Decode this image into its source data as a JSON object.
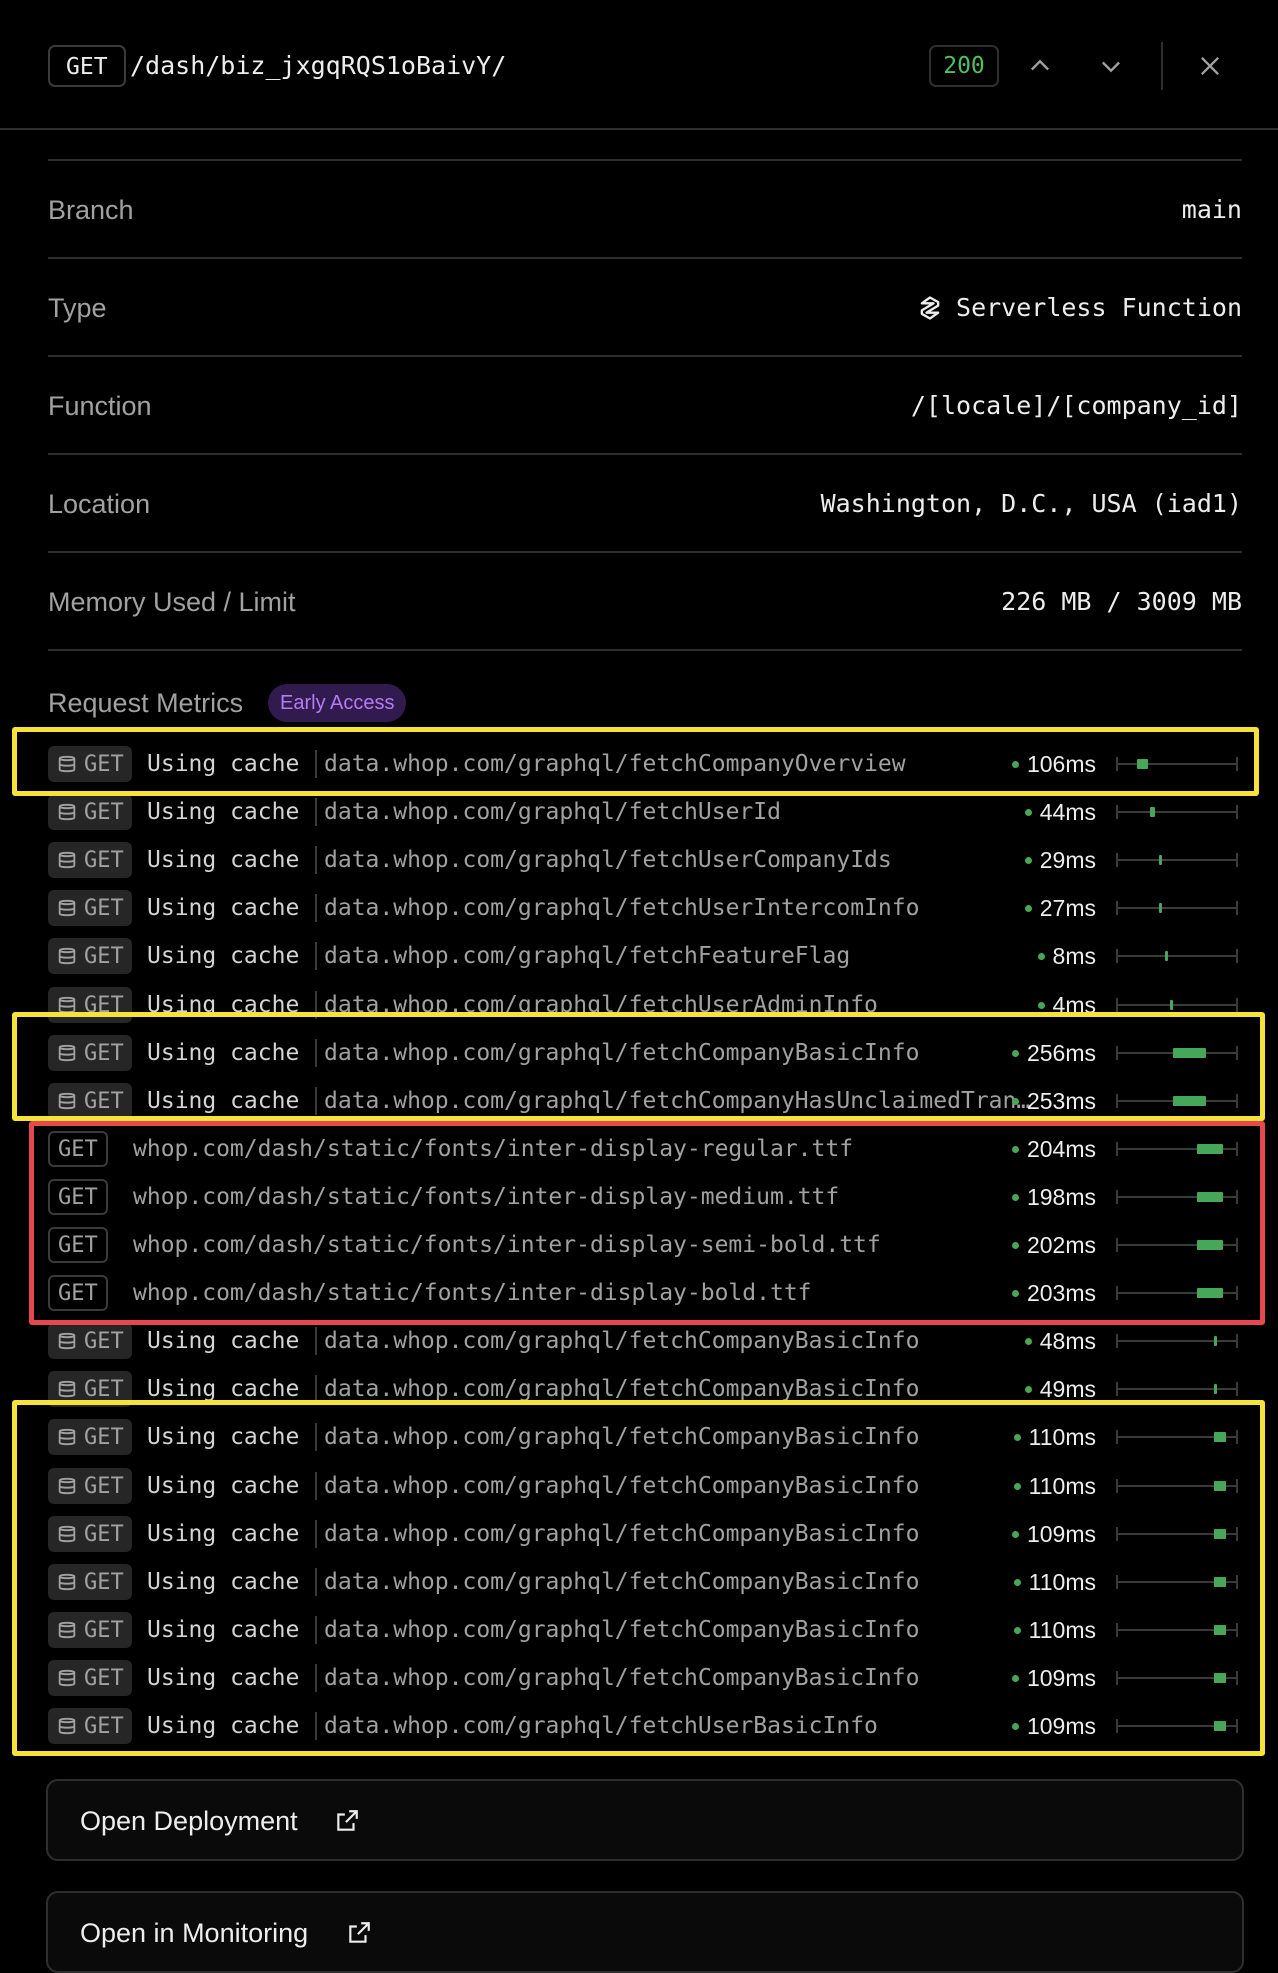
{
  "header": {
    "method": "GET",
    "path": "/dash/biz_jxgqRQS1oBaivY/",
    "status": "200",
    "prev_icon": "chevron-up-icon",
    "next_icon": "chevron-down-icon",
    "close_icon": "close-icon"
  },
  "details": [
    {
      "label": "Branch",
      "value": "main"
    },
    {
      "label": "Type",
      "value": "Serverless Function",
      "icon": "serverless-function-icon"
    },
    {
      "label": "Function",
      "value": "/[locale]/[company_id]"
    },
    {
      "label": "Location",
      "value": "Washington, D.C., USA (iad1)"
    },
    {
      "label": "Memory Used / Limit",
      "value": "226 MB / 3009 MB"
    }
  ],
  "metrics": {
    "title": "Request Metrics",
    "badge": "Early Access",
    "rows": [
      {
        "method": "GET",
        "cached": true,
        "cache_label": "Using cache",
        "url": "data.whop.com/graphql/fetchCompanyOverview",
        "duration": "106ms",
        "bar_start": 0.17,
        "bar_width": 0.09
      },
      {
        "method": "GET",
        "cached": true,
        "cache_label": "Using cache",
        "url": "data.whop.com/graphql/fetchUserId",
        "duration": "44ms",
        "bar_start": 0.28,
        "bar_width": 0.04
      },
      {
        "method": "GET",
        "cached": true,
        "cache_label": "Using cache",
        "url": "data.whop.com/graphql/fetchUserCompanyIds",
        "duration": "29ms",
        "bar_start": 0.35,
        "bar_width": 0.025
      },
      {
        "method": "GET",
        "cached": true,
        "cache_label": "Using cache",
        "url": "data.whop.com/graphql/fetchUserIntercomInfo",
        "duration": "27ms",
        "bar_start": 0.35,
        "bar_width": 0.025
      },
      {
        "method": "GET",
        "cached": true,
        "cache_label": "Using cache",
        "url": "data.whop.com/graphql/fetchFeatureFlag",
        "duration": "8ms",
        "bar_start": 0.4,
        "bar_width": 0.015
      },
      {
        "method": "GET",
        "cached": true,
        "cache_label": "Using cache",
        "url": "data.whop.com/graphql/fetchUserAdminInfo",
        "duration": "4ms",
        "bar_start": 0.44,
        "bar_width": 0.015
      },
      {
        "method": "GET",
        "cached": true,
        "cache_label": "Using cache",
        "url": "data.whop.com/graphql/fetchCompanyBasicInfo",
        "duration": "256ms",
        "bar_start": 0.47,
        "bar_width": 0.27
      },
      {
        "method": "GET",
        "cached": true,
        "cache_label": "Using cache",
        "url": "data.whop.com/graphql/fetchCompanyHasUnclaimedTransfers",
        "duration": "253ms",
        "bar_start": 0.47,
        "bar_width": 0.27
      },
      {
        "method": "GET",
        "cached": false,
        "url": "whop.com/dash/static/fonts/inter-display-regular.ttf",
        "duration": "204ms",
        "bar_start": 0.66,
        "bar_width": 0.22
      },
      {
        "method": "GET",
        "cached": false,
        "url": "whop.com/dash/static/fonts/inter-display-medium.ttf",
        "duration": "198ms",
        "bar_start": 0.66,
        "bar_width": 0.22
      },
      {
        "method": "GET",
        "cached": false,
        "url": "whop.com/dash/static/fonts/inter-display-semi-bold.ttf",
        "duration": "202ms",
        "bar_start": 0.66,
        "bar_width": 0.22
      },
      {
        "method": "GET",
        "cached": false,
        "url": "whop.com/dash/static/fonts/inter-display-bold.ttf",
        "duration": "203ms",
        "bar_start": 0.66,
        "bar_width": 0.22
      },
      {
        "method": "GET",
        "cached": true,
        "cache_label": "Using cache",
        "url": "data.whop.com/graphql/fetchCompanyBasicInfo",
        "duration": "48ms",
        "bar_start": 0.8,
        "bar_width": 0.03
      },
      {
        "method": "GET",
        "cached": true,
        "cache_label": "Using cache",
        "url": "data.whop.com/graphql/fetchCompanyBasicInfo",
        "duration": "49ms",
        "bar_start": 0.8,
        "bar_width": 0.03
      },
      {
        "method": "GET",
        "cached": true,
        "cache_label": "Using cache",
        "url": "data.whop.com/graphql/fetchCompanyBasicInfo",
        "duration": "110ms",
        "bar_start": 0.8,
        "bar_width": 0.1
      },
      {
        "method": "GET",
        "cached": true,
        "cache_label": "Using cache",
        "url": "data.whop.com/graphql/fetchCompanyBasicInfo",
        "duration": "110ms",
        "bar_start": 0.8,
        "bar_width": 0.1
      },
      {
        "method": "GET",
        "cached": true,
        "cache_label": "Using cache",
        "url": "data.whop.com/graphql/fetchCompanyBasicInfo",
        "duration": "109ms",
        "bar_start": 0.8,
        "bar_width": 0.1
      },
      {
        "method": "GET",
        "cached": true,
        "cache_label": "Using cache",
        "url": "data.whop.com/graphql/fetchCompanyBasicInfo",
        "duration": "110ms",
        "bar_start": 0.8,
        "bar_width": 0.1
      },
      {
        "method": "GET",
        "cached": true,
        "cache_label": "Using cache",
        "url": "data.whop.com/graphql/fetchCompanyBasicInfo",
        "duration": "110ms",
        "bar_start": 0.8,
        "bar_width": 0.1
      },
      {
        "method": "GET",
        "cached": true,
        "cache_label": "Using cache",
        "url": "data.whop.com/graphql/fetchCompanyBasicInfo",
        "duration": "109ms",
        "bar_start": 0.8,
        "bar_width": 0.1
      },
      {
        "method": "GET",
        "cached": true,
        "cache_label": "Using cache",
        "url": "data.whop.com/graphql/fetchUserBasicInfo",
        "duration": "109ms",
        "bar_start": 0.8,
        "bar_width": 0.1
      }
    ]
  },
  "actions": {
    "open_deployment": "Open Deployment",
    "open_monitoring": "Open in Monitoring"
  },
  "colors": {
    "background": "#000000",
    "status_ok": "#4ec15c",
    "bar": "#46a758",
    "badge_bg": "#301a4e",
    "badge_text": "#b57cf2",
    "highlight_yellow": "#f5e23b",
    "highlight_red": "#e5484d"
  }
}
